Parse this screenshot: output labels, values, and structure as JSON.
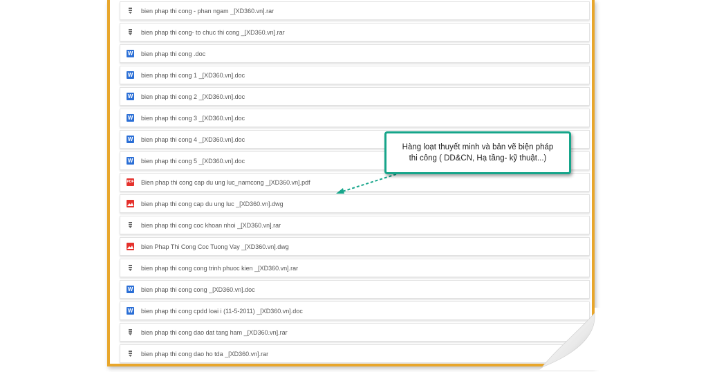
{
  "files": [
    {
      "type": "archive-icon",
      "name": "bien phap thi cong - phan ngam _[XD360.vn].rar"
    },
    {
      "type": "archive-icon",
      "name": "bien phap thi cong- to chuc thi cong _[XD360.vn].rar"
    },
    {
      "type": "word-icon",
      "name": "bien phap thi cong .doc"
    },
    {
      "type": "word-icon",
      "name": "bien phap thi cong 1 _[XD360.vn].doc"
    },
    {
      "type": "word-icon",
      "name": "bien phap thi cong 2 _[XD360.vn].doc"
    },
    {
      "type": "word-icon",
      "name": "bien phap thi cong 3 _[XD360.vn].doc"
    },
    {
      "type": "word-icon",
      "name": "bien phap thi cong 4 _[XD360.vn].doc"
    },
    {
      "type": "word-icon",
      "name": "bien phap thi cong 5 _[XD360.vn].doc"
    },
    {
      "type": "pdf-icon",
      "name": "Bien phap thi cong cap du ung luc_namcong _[XD360.vn].pdf"
    },
    {
      "type": "image-icon",
      "name": "bien phap thi cong cap du ung luc _[XD360.vn].dwg"
    },
    {
      "type": "archive-icon",
      "name": "bien phap thi cong coc khoan nhoi _[XD360.vn].rar"
    },
    {
      "type": "image-icon",
      "name": "bien Phap Thi Cong Coc Tuong Vay _[XD360.vn].dwg"
    },
    {
      "type": "archive-icon",
      "name": "bien phap thi cong cong trinh phuoc kien _[XD360.vn].rar"
    },
    {
      "type": "word-icon",
      "name": "bien phap thi cong cong _[XD360.vn].doc"
    },
    {
      "type": "word-icon",
      "name": "bien phap thi cong cpdd loai i (11-5-2011) _[XD360.vn].doc"
    },
    {
      "type": "archive-icon",
      "name": "bien phap thi cong dao dat tang ham _[XD360.vn].rar"
    },
    {
      "type": "archive-icon",
      "name": "bien phap thi cong dao ho tda _[XD360.vn].rar"
    }
  ],
  "icon_glyphs": {
    "word": "W",
    "pdf": "PDF"
  },
  "callout": {
    "line1": "Hàng loạt thuyết minh và bản vẽ biện pháp",
    "line2": "thi công ( DD&CN, Hạ tầng- kỹ thuật...)"
  },
  "colors": {
    "frame_border": "#e8a62b",
    "callout_border": "#16a58a",
    "word_icon": "#2b6fd6",
    "pdf_icon": "#e5312c"
  }
}
